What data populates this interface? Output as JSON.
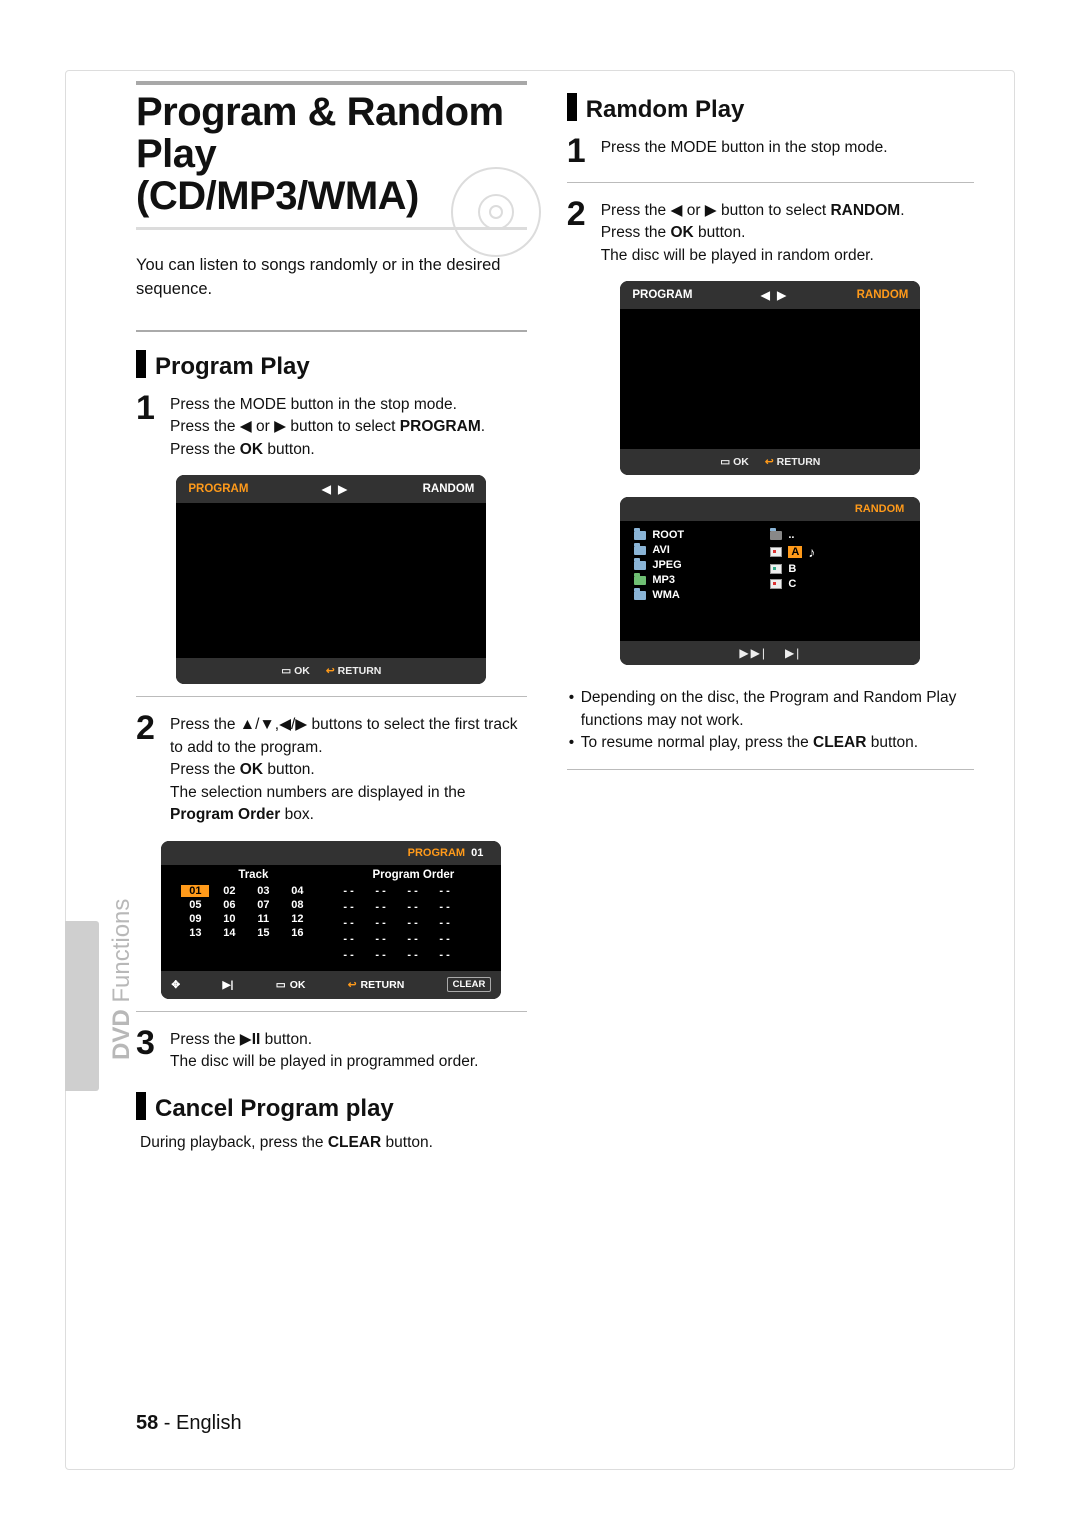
{
  "page": {
    "number": "58",
    "language": "English"
  },
  "side_label": {
    "main": "DVD",
    "sub": "Functions"
  },
  "title": {
    "line1": "Program & Random Play",
    "line2": "(CD/MP3/WMA)"
  },
  "intro": "You can listen to songs randomly or in the desired sequence.",
  "sections": {
    "program_play": {
      "heading": "Program Play",
      "step1": {
        "l1": "Press the MODE button in the stop mode.",
        "l2a": "Press the ",
        "l2b_or": " or ",
        "l2c": " button to select ",
        "l2_bold": "PROGRAM",
        "l2d": ".",
        "l3a": "Press the ",
        "l3_bold": "OK",
        "l3b": " button."
      },
      "step2": {
        "l1a": "Press the ",
        "l1b": " buttons to select the first track to add to the program.",
        "l2a": "Press the ",
        "l2_bold": "OK",
        "l2b": " button.",
        "l3a": "The selection numbers are displayed in the ",
        "l3_bold": "Program Order",
        "l3b": " box."
      },
      "step3": {
        "l1a": "Press the ",
        "l1b": " button.",
        "l2": "The disc will be played in programmed order."
      }
    },
    "cancel": {
      "heading": "Cancel Program play",
      "text_a": "During playback, press the ",
      "text_bold": "CLEAR",
      "text_b": " button."
    },
    "random_play": {
      "heading": "Ramdom Play",
      "step1": "Press the MODE button in the stop mode.",
      "step2": {
        "l1a": "Press the ",
        "l1b_or": " or ",
        "l1c": " button to select ",
        "l1_bold": "RANDOM",
        "l1d": ".",
        "l2a": "Press the ",
        "l2_bold": "OK",
        "l2b": " button.",
        "l3": "The disc will be played in random order."
      },
      "bullets": {
        "b1": "Depending on the disc, the Program and Random Play functions may not work.",
        "b2a": "To resume normal play, press the ",
        "b2_bold": "CLEAR",
        "b2b": " button."
      }
    }
  },
  "osd": {
    "tab_program": "PROGRAM",
    "tab_random": "RANDOM",
    "arrows": "◀ ▶",
    "ok": "OK",
    "ok_icon": "▭",
    "return": "RETURN",
    "return_icon": "↩",
    "program_header": "PROGRAM",
    "program_num": "01",
    "track_title": "Track",
    "order_title": "Program Order",
    "tracks": [
      "01",
      "02",
      "03",
      "04",
      "05",
      "06",
      "07",
      "08",
      "09",
      "10",
      "11",
      "12",
      "13",
      "14",
      "15",
      "16"
    ],
    "selected_track_index": 0,
    "order_slots": 20,
    "pf_move": "✥",
    "pf_skip": "▶|",
    "pf_ok": "OK",
    "pf_return": "RETURN",
    "pf_clear": "CLEAR",
    "files_header": "RANDOM",
    "files_left": [
      "ROOT",
      "AVI",
      "JPEG",
      "MP3",
      "WMA"
    ],
    "files_right_parent": "..",
    "files_right": [
      "A",
      "B",
      "C"
    ],
    "selected_file_index": 0,
    "ff_next": "▶▶|",
    "ff_skip": "▶|"
  }
}
